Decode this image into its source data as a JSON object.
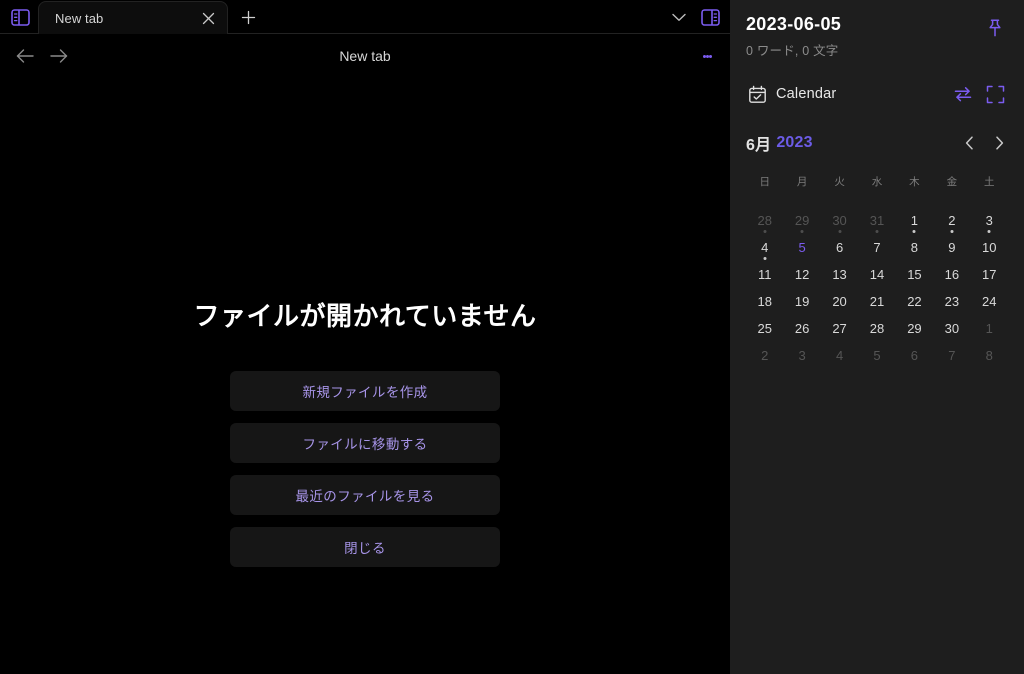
{
  "window": {
    "left_panel_toggle_icon": "sidebar-left-icon",
    "right_panel_toggle_icon": "sidebar-right-icon",
    "tab_list_chevron_icon": "chevron-down-icon"
  },
  "tabs": [
    {
      "title": "New tab",
      "close_icon": "close-icon",
      "active": true
    }
  ],
  "tabbar": {
    "new_tab_icon": "plus-icon",
    "new_tab_label": "+"
  },
  "toolbar": {
    "back_icon": "arrow-left-icon",
    "forward_icon": "arrow-right-icon",
    "doc_title": "New tab",
    "more_icon": "more-vertical-icon"
  },
  "empty_state": {
    "title": "ファイルが開かれていません",
    "buttons": [
      {
        "label": "新規ファイルを作成",
        "name": "create-new-file-button"
      },
      {
        "label": "ファイルに移動する",
        "name": "go-to-file-button"
      },
      {
        "label": "最近のファイルを見る",
        "name": "recent-files-button"
      },
      {
        "label": "閉じる",
        "name": "close-button"
      }
    ]
  },
  "sidepanel": {
    "date": "2023-06-05",
    "counts": "0 ワード, 0 文字",
    "pin_icon": "pin-icon",
    "section": {
      "icon": "calendar-check-icon",
      "label": "Calendar",
      "swap_icon": "swap-arrows-icon",
      "expand_icon": "expand-icon"
    }
  },
  "calendar": {
    "month_label": "6月",
    "year_label": "2023",
    "prev_icon": "chevron-left-icon",
    "next_icon": "chevron-right-icon",
    "weekdays": [
      "日",
      "月",
      "火",
      "水",
      "木",
      "金",
      "土"
    ],
    "days": [
      {
        "n": "28",
        "out": true,
        "dot": true,
        "sel": false
      },
      {
        "n": "29",
        "out": true,
        "dot": true,
        "sel": false
      },
      {
        "n": "30",
        "out": true,
        "dot": true,
        "sel": false
      },
      {
        "n": "31",
        "out": true,
        "dot": true,
        "sel": false
      },
      {
        "n": "1",
        "out": false,
        "dot": true,
        "sel": false
      },
      {
        "n": "2",
        "out": false,
        "dot": true,
        "sel": false
      },
      {
        "n": "3",
        "out": false,
        "dot": true,
        "sel": false
      },
      {
        "n": "4",
        "out": false,
        "dot": true,
        "sel": false
      },
      {
        "n": "5",
        "out": false,
        "dot": false,
        "sel": true
      },
      {
        "n": "6",
        "out": false,
        "dot": false,
        "sel": false
      },
      {
        "n": "7",
        "out": false,
        "dot": false,
        "sel": false
      },
      {
        "n": "8",
        "out": false,
        "dot": false,
        "sel": false
      },
      {
        "n": "9",
        "out": false,
        "dot": false,
        "sel": false
      },
      {
        "n": "10",
        "out": false,
        "dot": false,
        "sel": false
      },
      {
        "n": "11",
        "out": false,
        "dot": false,
        "sel": false
      },
      {
        "n": "12",
        "out": false,
        "dot": false,
        "sel": false
      },
      {
        "n": "13",
        "out": false,
        "dot": false,
        "sel": false
      },
      {
        "n": "14",
        "out": false,
        "dot": false,
        "sel": false
      },
      {
        "n": "15",
        "out": false,
        "dot": false,
        "sel": false
      },
      {
        "n": "16",
        "out": false,
        "dot": false,
        "sel": false
      },
      {
        "n": "17",
        "out": false,
        "dot": false,
        "sel": false
      },
      {
        "n": "18",
        "out": false,
        "dot": false,
        "sel": false
      },
      {
        "n": "19",
        "out": false,
        "dot": false,
        "sel": false
      },
      {
        "n": "20",
        "out": false,
        "dot": false,
        "sel": false
      },
      {
        "n": "21",
        "out": false,
        "dot": false,
        "sel": false
      },
      {
        "n": "22",
        "out": false,
        "dot": false,
        "sel": false
      },
      {
        "n": "23",
        "out": false,
        "dot": false,
        "sel": false
      },
      {
        "n": "24",
        "out": false,
        "dot": false,
        "sel": false
      },
      {
        "n": "25",
        "out": false,
        "dot": false,
        "sel": false
      },
      {
        "n": "26",
        "out": false,
        "dot": false,
        "sel": false
      },
      {
        "n": "27",
        "out": false,
        "dot": false,
        "sel": false
      },
      {
        "n": "28",
        "out": false,
        "dot": false,
        "sel": false
      },
      {
        "n": "29",
        "out": false,
        "dot": false,
        "sel": false
      },
      {
        "n": "30",
        "out": false,
        "dot": false,
        "sel": false
      },
      {
        "n": "1",
        "out": true,
        "dot": false,
        "sel": false
      },
      {
        "n": "2",
        "out": true,
        "dot": false,
        "sel": false
      },
      {
        "n": "3",
        "out": true,
        "dot": false,
        "sel": false
      },
      {
        "n": "4",
        "out": true,
        "dot": false,
        "sel": false
      },
      {
        "n": "5",
        "out": true,
        "dot": false,
        "sel": false
      },
      {
        "n": "6",
        "out": true,
        "dot": false,
        "sel": false
      },
      {
        "n": "7",
        "out": true,
        "dot": false,
        "sel": false
      },
      {
        "n": "8",
        "out": true,
        "dot": false,
        "sel": false
      }
    ]
  },
  "colors": {
    "accent": "#7b5cf0",
    "accent_text": "#a794e8",
    "panel_bg": "#1e1e1e",
    "editor_bg": "#000000",
    "button_bg": "#161616"
  }
}
